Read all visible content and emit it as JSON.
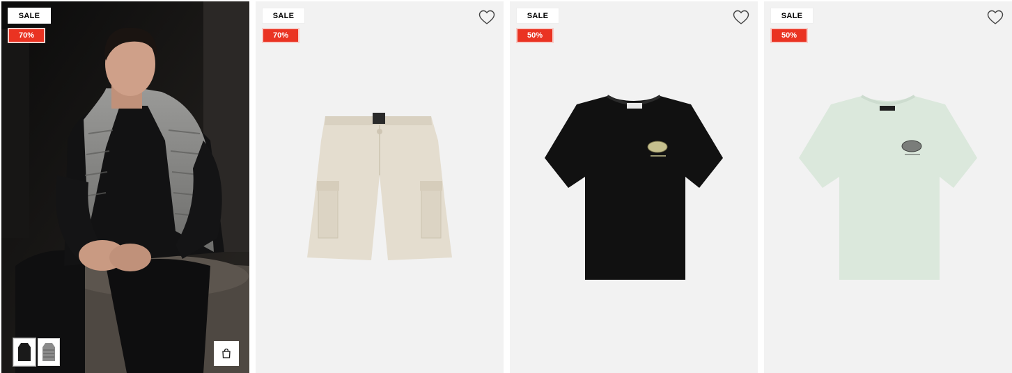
{
  "products": [
    {
      "sale_label": "SALE",
      "discount_label": "70%",
      "image": "model-wearing-grey-puffer-vest",
      "thumbnails": [
        "black-vest-thumbnail",
        "grey-vest-thumbnail"
      ],
      "quick_add_icon": "shopping-bag-icon"
    },
    {
      "sale_label": "SALE",
      "discount_label": "70%",
      "image": "beige-cargo-shorts",
      "wishlist_icon": "heart-icon"
    },
    {
      "sale_label": "SALE",
      "discount_label": "50%",
      "image": "black-tshirt-with-logo",
      "wishlist_icon": "heart-icon"
    },
    {
      "sale_label": "SALE",
      "discount_label": "50%",
      "image": "mint-tshirt-with-logo",
      "wishlist_icon": "heart-icon"
    }
  ],
  "colors": {
    "discount_badge": "#ea3322",
    "card_background": "#f2f2f2"
  }
}
